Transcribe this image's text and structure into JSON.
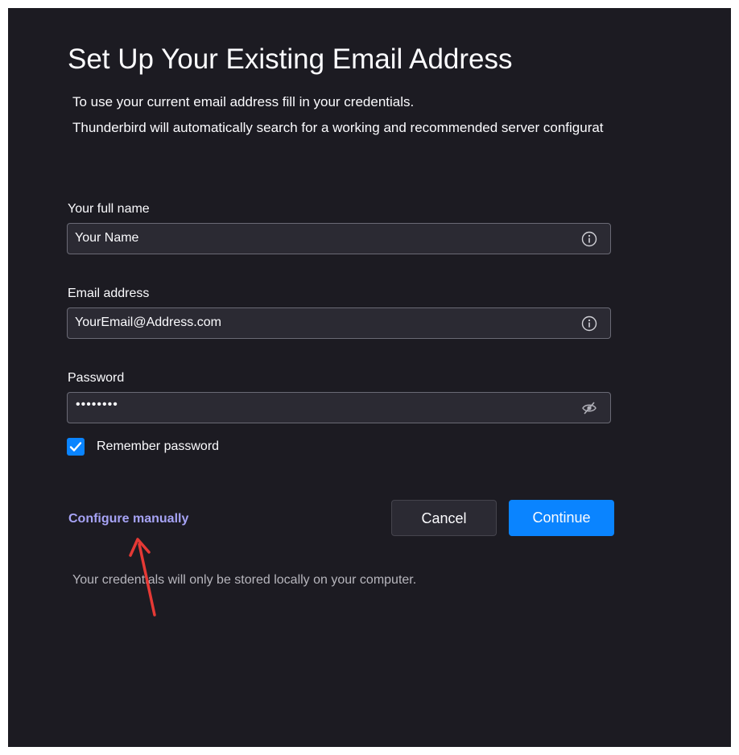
{
  "title": "Set Up Your Existing Email Address",
  "intro": {
    "line1": "To use your current email address fill in your credentials.",
    "line2": "Thunderbird will automatically search for a working and recommended server configurat"
  },
  "fields": {
    "name": {
      "label": "Your full name",
      "value": "Your Name",
      "icon": "info-icon"
    },
    "email": {
      "label": "Email address",
      "value": "YourEmail@Address.com",
      "icon": "info-icon"
    },
    "password": {
      "label": "Password",
      "masked_value": "••••••••",
      "icon": "eye-slash-icon"
    }
  },
  "remember": {
    "label": "Remember password",
    "checked": true
  },
  "configure_link": "Configure manually",
  "buttons": {
    "cancel": "Cancel",
    "continue": "Continue"
  },
  "footnote": "Your credentials will only be stored locally on your computer.",
  "colors": {
    "background": "#1c1b22",
    "input": "#2b2a33",
    "accent": "#0a84ff",
    "link": "#a6a3f5",
    "annotation_arrow": "#e53935"
  }
}
